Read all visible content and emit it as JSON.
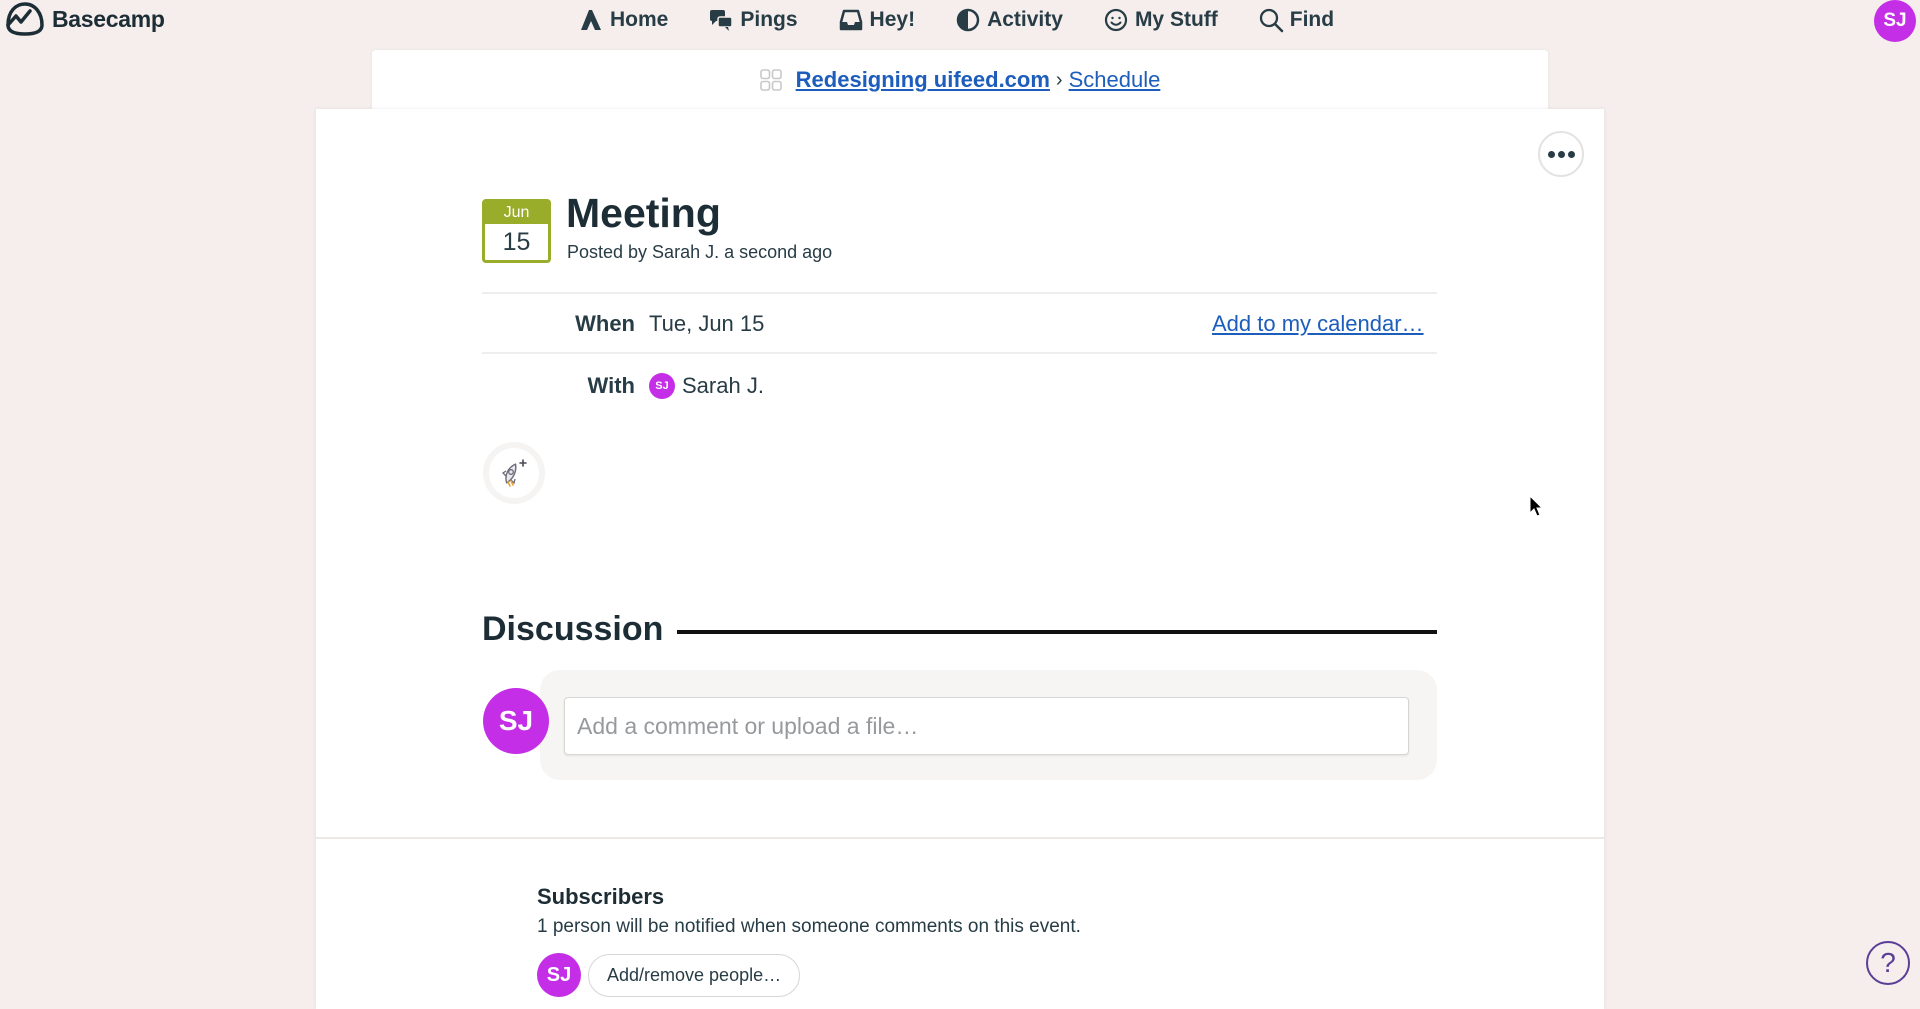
{
  "app": {
    "name": "Basecamp",
    "brand_color": "#1d2d35",
    "avatar_color": "#c42ee6",
    "link_color": "#1d5dbb"
  },
  "nav": {
    "items": [
      {
        "label": "Home",
        "icon": "home-icon"
      },
      {
        "label": "Pings",
        "icon": "pings-icon"
      },
      {
        "label": "Hey!",
        "icon": "hey-inbox-icon"
      },
      {
        "label": "Activity",
        "icon": "activity-icon"
      },
      {
        "label": "My Stuff",
        "icon": "my-stuff-icon"
      },
      {
        "label": "Find",
        "icon": "search-icon"
      }
    ],
    "user_initials": "SJ"
  },
  "breadcrumb": {
    "project": "Redesigning uifeed.com",
    "separator": "›",
    "tool": "Schedule"
  },
  "event": {
    "calendar_month": "Jun",
    "calendar_day": "15",
    "calendar_color": "#9aad2b",
    "title": "Meeting",
    "meta": "Posted by Sarah J. a second ago",
    "when_label": "When",
    "when_value": "Tue, Jun 15",
    "add_to_calendar": "Add to my calendar…",
    "with_label": "With",
    "with_initials": "SJ",
    "with_name": "Sarah J."
  },
  "discussion": {
    "title": "Discussion",
    "avatar_initials": "SJ",
    "comment_placeholder": "Add a comment or upload a file…"
  },
  "subscribers": {
    "title": "Subscribers",
    "description": "1 person will be notified when someone comments on this event.",
    "avatar_initials": "SJ",
    "button_label": "Add/remove people…"
  },
  "help": {
    "label": "?"
  }
}
